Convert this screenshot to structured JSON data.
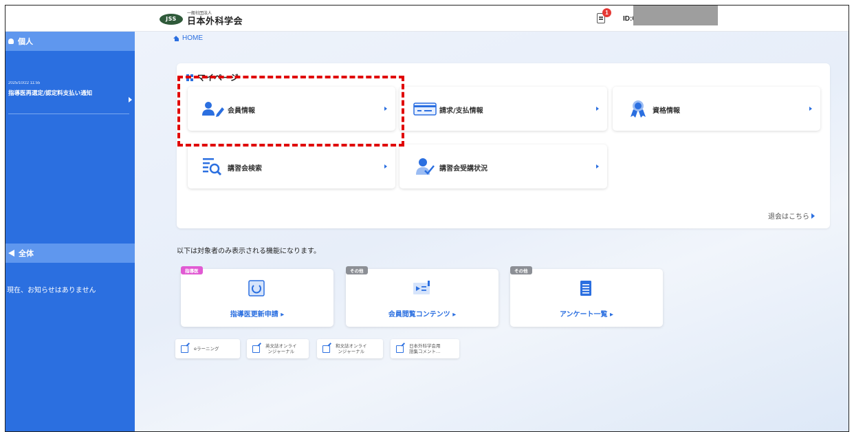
{
  "header": {
    "org_sub": "一般社団法人",
    "org_name": "日本外科学会",
    "logo_abbr": "JSS",
    "notification_count": "1",
    "user_id_label": "ID:0"
  },
  "sidebar": {
    "personal_section": "個人",
    "notice_date": "2025/10/22 11:55",
    "notice_title": "指導医再選定/認定料支払い通知",
    "all_section": "全体",
    "all_empty": "現在、お知らせはありません"
  },
  "breadcrumb": {
    "home": "HOME"
  },
  "mypage": {
    "title": "マイページ",
    "menu": [
      {
        "label": "会員情報",
        "icon": "member-edit-icon"
      },
      {
        "label": "請求/支払情報",
        "icon": "payment-card-icon"
      },
      {
        "label": "資格情報",
        "icon": "award-ribbon-icon"
      },
      {
        "label": "講習会検索",
        "icon": "search-document-icon"
      },
      {
        "label": "講習会受講状況",
        "icon": "attendance-check-icon"
      }
    ],
    "withdraw_link": "退会はこちら"
  },
  "targets_note": "以下は対象者のみ表示される機能になります。",
  "features": [
    {
      "tag": "指導医",
      "label": "指導医更新申請 ▸",
      "icon": "renew-icon"
    },
    {
      "tag": "その他",
      "label": "会員閲覧コンテンツ ▸",
      "icon": "media-content-icon"
    },
    {
      "tag": "その他",
      "label": "アンケート一覧 ▸",
      "icon": "survey-list-icon"
    }
  ],
  "external_links": [
    {
      "label": "eラーニング"
    },
    {
      "label_line1": "英文誌オンライ",
      "label_line2": "ンジャーナル"
    },
    {
      "label_line1": "和文誌オンライ",
      "label_line2": "ンジャーナル"
    },
    {
      "label_line1": "日本外科学会用",
      "label_line2": "語集コメント…"
    }
  ],
  "colors": {
    "primary": "#2b6fe0",
    "sidebar_section": "#5f97ee",
    "highlight": "#e00000",
    "tag_pink": "#e15ad3",
    "tag_gray": "#8c8f95",
    "badge_red": "#e53935"
  }
}
